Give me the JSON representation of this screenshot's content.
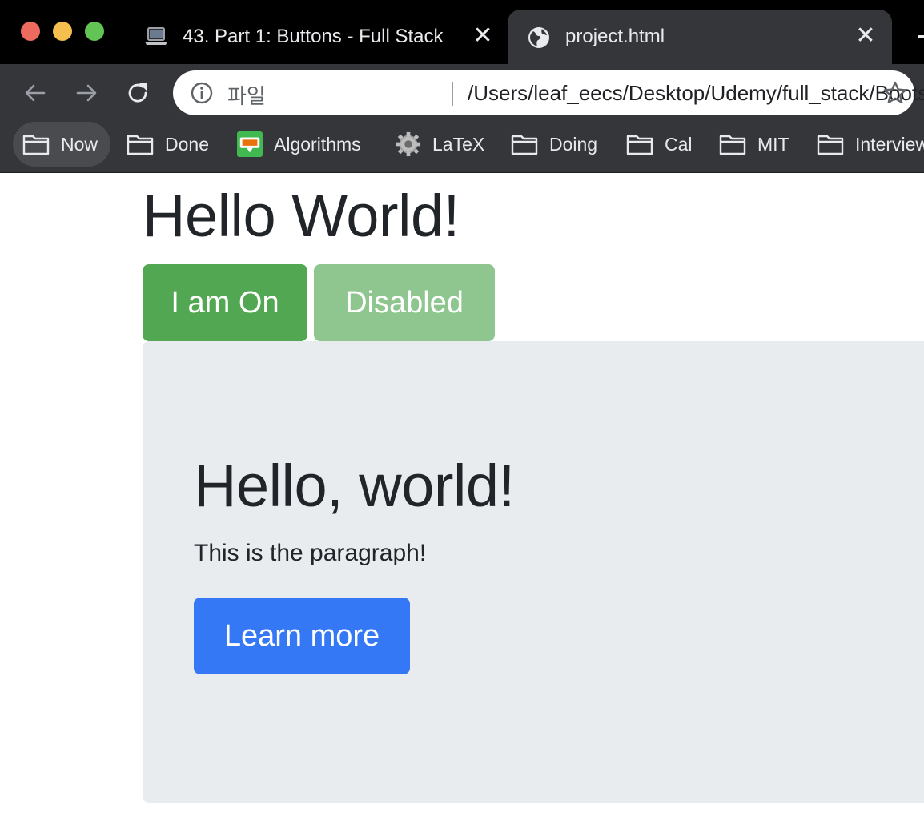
{
  "browser": {
    "tabs": [
      {
        "title": "43. Part 1: Buttons - Full Stack",
        "favicon": "laptop-icon",
        "active": false
      },
      {
        "title": "project.html",
        "favicon": "globe-icon",
        "active": true
      }
    ],
    "address_bar": {
      "scheme_label": "파일",
      "url": "/Users/leaf_eecs/Desktop/Udemy/full_stack/Bootstra..."
    },
    "bookmarks": [
      {
        "label": "Now",
        "icon": "folder-icon"
      },
      {
        "label": "Done",
        "icon": "folder-icon"
      },
      {
        "label": "Algorithms",
        "icon": "blog-icon"
      },
      {
        "label": "LaTeX",
        "icon": "gear-icon"
      },
      {
        "label": "Doing",
        "icon": "folder-icon"
      },
      {
        "label": "Cal",
        "icon": "folder-icon"
      },
      {
        "label": "MIT",
        "icon": "folder-icon"
      },
      {
        "label": "Interview",
        "icon": "folder-icon"
      }
    ]
  },
  "page": {
    "heading": "Hello World!",
    "buttons": {
      "on_label": "I am On",
      "disabled_label": "Disabled"
    },
    "jumbotron": {
      "title": "Hello, world!",
      "text": "This is the paragraph!",
      "button_label": "Learn more"
    }
  },
  "colors": {
    "success": "#52a752",
    "success_disabled": "#8fc68f",
    "primary": "#3478f6",
    "jumbotron_bg": "#e9ecef",
    "text": "#212529"
  }
}
